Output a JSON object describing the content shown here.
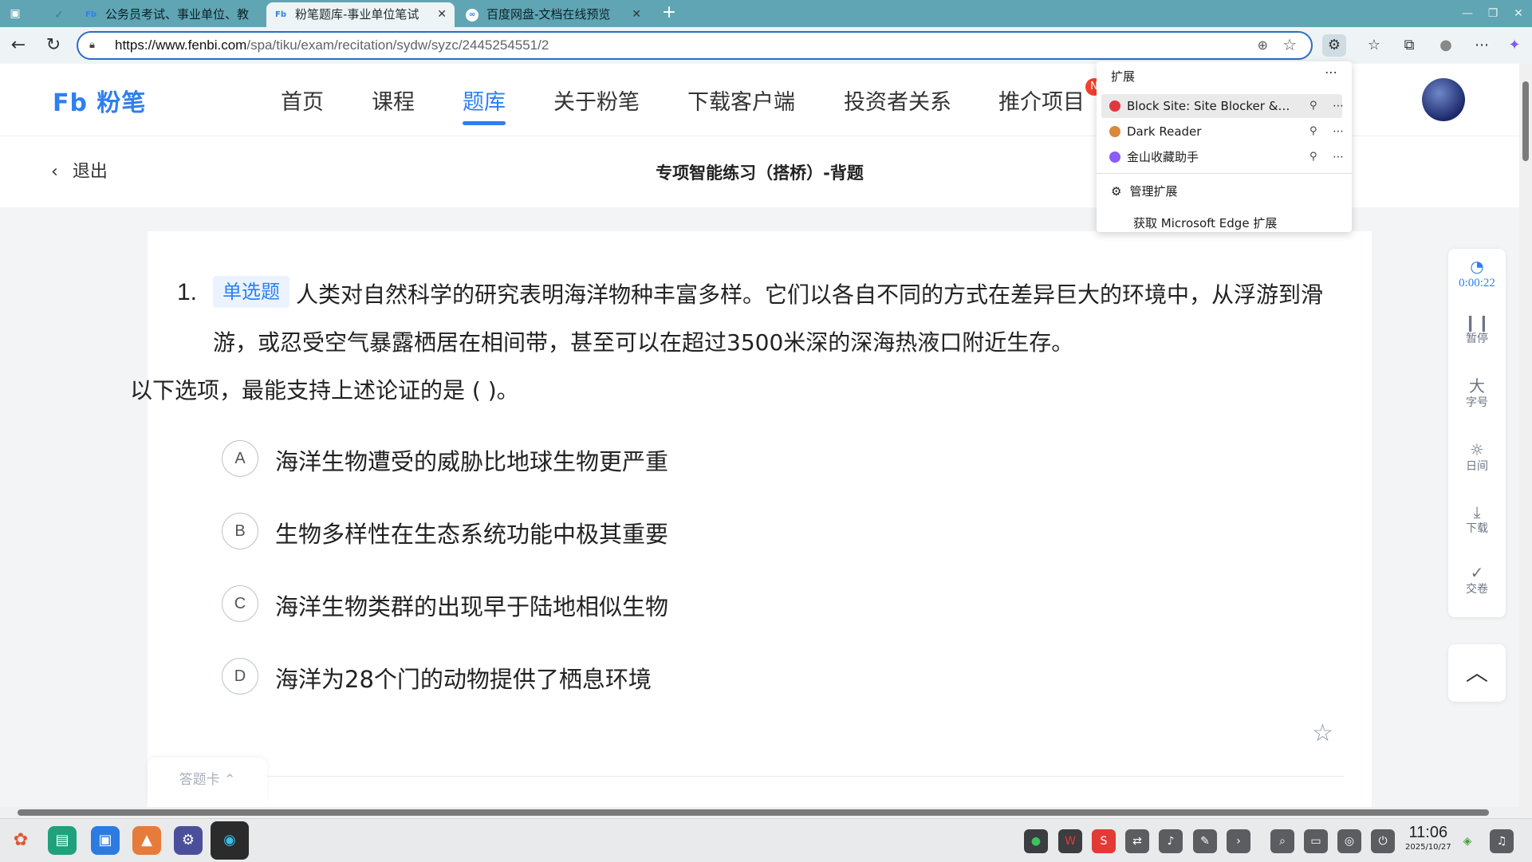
{
  "browser": {
    "tabs": [
      {
        "title": "",
        "icon": "check-icon"
      },
      {
        "title": "公务员考试、事业单位、教",
        "icon": "fenbi-icon"
      },
      {
        "title": "粉笔题库-事业单位笔试",
        "icon": "fenbi-icon"
      },
      {
        "title": "百度网盘-文档在线预览",
        "icon": "baidu-icon"
      }
    ],
    "new_tab": "+",
    "url_host": "https://www.fenbi.com",
    "url_path": "/spa/tiku/exam/recitation/sydw/syzc/2445254551/2"
  },
  "extensions": {
    "title": "扩展",
    "items": [
      {
        "name": "Block Site: Site Blocker &…",
        "color": "#e0383e"
      },
      {
        "name": "Dark Reader",
        "color": "#d9893a"
      },
      {
        "name": "金山收藏助手",
        "color": "#8b5cf6"
      }
    ],
    "manage": "管理扩展",
    "get": "获取 Microsoft Edge 扩展"
  },
  "site": {
    "logo": "Fb 粉笔",
    "nav": [
      "首页",
      "课程",
      "题库",
      "关于粉笔",
      "下载客户端",
      "投资者关系",
      "推介项目"
    ],
    "active_nav": "题库",
    "badge": "N",
    "back": "退出",
    "page_title": "专项智能练习（搭桥）-背题"
  },
  "question": {
    "number": "1.",
    "type": "单选题",
    "text": "人类对自然科学的研究表明海洋物种丰富多样。它们以各自不同的方式在差异巨大的环境中，从浮游到滑游，或忍受空气暴露栖居在相间带，甚至可以在超过3500米深的深海热液口附近生存。",
    "prompt": "以下选项，最能支持上述论证的是 ( )。",
    "options": [
      {
        "letter": "A",
        "text": "海洋生物遭受的威胁比地球生物更严重"
      },
      {
        "letter": "B",
        "text": "生物多样性在生态系统功能中极其重要"
      },
      {
        "letter": "C",
        "text": "海洋生物类群的出现早于陆地相似生物"
      },
      {
        "letter": "D",
        "text": "海洋为28个门的动物提供了栖息环境"
      }
    ],
    "answer_card": "答题卡"
  },
  "side": {
    "timer": "0:00:22",
    "pause": "暂停",
    "font_icon": "大",
    "font": "字号",
    "day": "日间",
    "download": "下载",
    "submit": "交卷"
  },
  "taskbar": {
    "time": "11:06",
    "date": "2025/10/27"
  },
  "colors": {
    "accent": "#2e7ff0",
    "tabstrip": "#5fa5b3"
  }
}
